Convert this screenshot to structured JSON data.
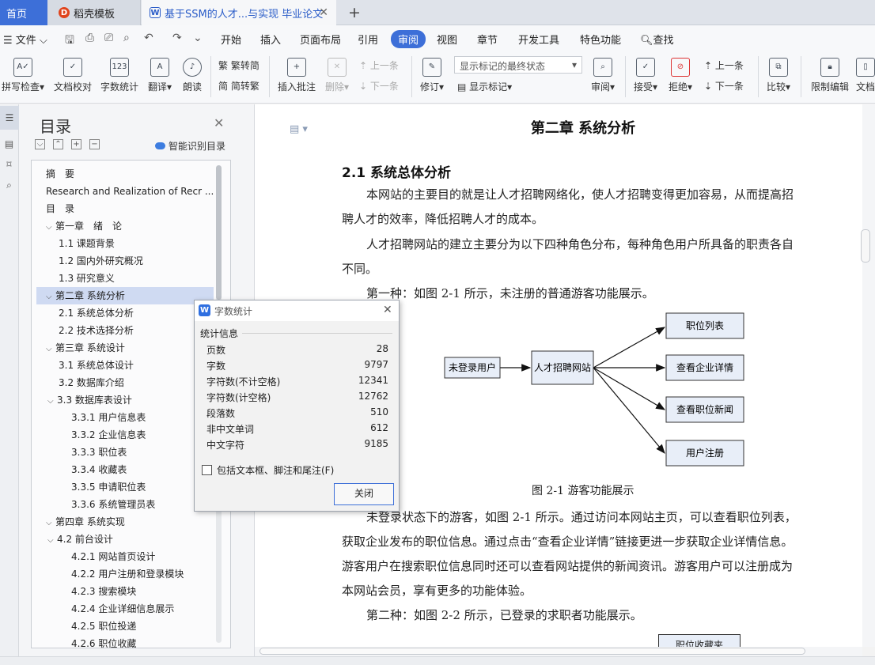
{
  "tabs": [
    {
      "label": "首页"
    },
    {
      "label": "稻壳模板",
      "icon": "doke-icon"
    },
    {
      "label": "基于SSM的人才...与实现 毕业论文",
      "icon": "wps-writer-icon"
    }
  ],
  "menubar": {
    "file": "文件",
    "items": [
      "开始",
      "插入",
      "页面布局",
      "引用",
      "审阅",
      "视图",
      "章节",
      "开发工具",
      "特色功能",
      "查找"
    ],
    "active": "审阅"
  },
  "ribbon": {
    "spellcheck": "拼写检查",
    "doc_proof": "文档校对",
    "word_count": "字数统计",
    "translate": "翻译",
    "read_aloud": "朗读",
    "to_traditional": "繁转简",
    "to_simplified": "简转繁",
    "insert_comment": "插入批注",
    "delete": "删除",
    "prev_item": "上一条",
    "next_item": "下一条",
    "revise": "修订",
    "show_markup_state": "显示标记的最终状态",
    "show_markup": "显示标记",
    "review": "审阅",
    "accept": "接受",
    "reject": "拒绝",
    "prev_change": "上一条",
    "next_change": "下一条",
    "compare": "比较",
    "restrict_edit": "限制编辑",
    "doc_more": "文档"
  },
  "toc": {
    "title": "目录",
    "smart_label": "智能识别目录",
    "items": [
      {
        "text": "摘　要",
        "level": 0
      },
      {
        "text": "Research and Realization of Recr ...",
        "level": 0
      },
      {
        "text": "目　录",
        "level": 0
      },
      {
        "text": "第一章　绪　论",
        "level": 0
      },
      {
        "text": "1.1 课题背景",
        "level": 1
      },
      {
        "text": "1.2 国内外研究概况",
        "level": 1
      },
      {
        "text": "1.3 研究意义",
        "level": 1
      },
      {
        "text": "第二章  系统分析",
        "level": 0
      },
      {
        "text": "2.1 系统总体分析",
        "level": 1
      },
      {
        "text": "2.2 技术选择分析",
        "level": 1
      },
      {
        "text": "第三章  系统设计",
        "level": 0
      },
      {
        "text": "3.1 系统总体设计",
        "level": 1
      },
      {
        "text": "3.2 数据库介绍",
        "level": 1
      },
      {
        "text": "3.3 数据库表设计",
        "level": 1
      },
      {
        "text": "3.3.1 用户信息表",
        "level": 2
      },
      {
        "text": "3.3.2 企业信息表",
        "level": 2
      },
      {
        "text": "3.3.3 职位表",
        "level": 2
      },
      {
        "text": "3.3.4 收藏表",
        "level": 2
      },
      {
        "text": "3.3.5 申请职位表",
        "level": 2
      },
      {
        "text": "3.3.6 系统管理员表",
        "level": 2
      },
      {
        "text": "第四章  系统实现",
        "level": 0
      },
      {
        "text": "4.2 前台设计",
        "level": 1
      },
      {
        "text": "4.2.1 网站首页设计",
        "level": 2
      },
      {
        "text": "4.2.2 用户注册和登录模块",
        "level": 2
      },
      {
        "text": "4.2.3 搜索模块",
        "level": 2
      },
      {
        "text": "4.2.4 企业详细信息展示",
        "level": 2
      },
      {
        "text": "4.2.5 职位投递",
        "level": 2
      },
      {
        "text": "4.2.6 职位收藏",
        "level": 2
      }
    ]
  },
  "document": {
    "chapter_title": "第二章  系统分析",
    "section_title": "2.1 系统总体分析",
    "paragraphs": [
      "本网站的主要目的就是让人才招聘网络化，使人才招聘变得更加容易，从而提高招",
      "聘人才的效率，降低招聘人才的成本。",
      "人才招聘网站的建立主要分为以下四种角色分布，每种角色用户所具备的职责各自",
      "不同。",
      "第一种：如图 2-1 所示，未注册的普通游客功能展示。"
    ],
    "paragraphs_after": [
      "未登录状态下的游客，如图 2-1 所示。通过访问本网站主页，可以查看职位列表，",
      "获取企业发布的职位信息。通过点击“查看企业详情”链接更进一步获取企业详情信息。",
      "游客用户在搜索职位信息同时还可以查看网站提供的新闻资讯。游客用户可以注册成为",
      "本网站会员，享有更多的功能体验。",
      "第二种：如图 2-2 所示，已登录的求职者功能展示。"
    ],
    "figure": {
      "caption": "图 2-1 游客功能展示",
      "source": "未登录用户",
      "center": "人才招聘网站",
      "targets": [
        "职位列表",
        "查看企业详情",
        "查看职位新闻",
        "用户注册"
      ]
    },
    "next_figure_box": "职位收藏夹"
  },
  "dialog": {
    "title": "字数统计",
    "section": "统计信息",
    "stats": [
      {
        "label": "页数",
        "value": "28"
      },
      {
        "label": "字数",
        "value": "9797"
      },
      {
        "label": "字符数(不计空格)",
        "value": "12341"
      },
      {
        "label": "字符数(计空格)",
        "value": "12762"
      },
      {
        "label": "段落数",
        "value": "510"
      },
      {
        "label": "非中文单词",
        "value": "612"
      },
      {
        "label": "中文字符",
        "value": "9185"
      }
    ],
    "include_label": "包括文本框、脚注和尾注(F)",
    "close_label": "关闭"
  },
  "colors": {
    "accent": "#3d6fd8",
    "toc_selected": "#cfdaf2",
    "diagram_box": "#e8eef8"
  }
}
